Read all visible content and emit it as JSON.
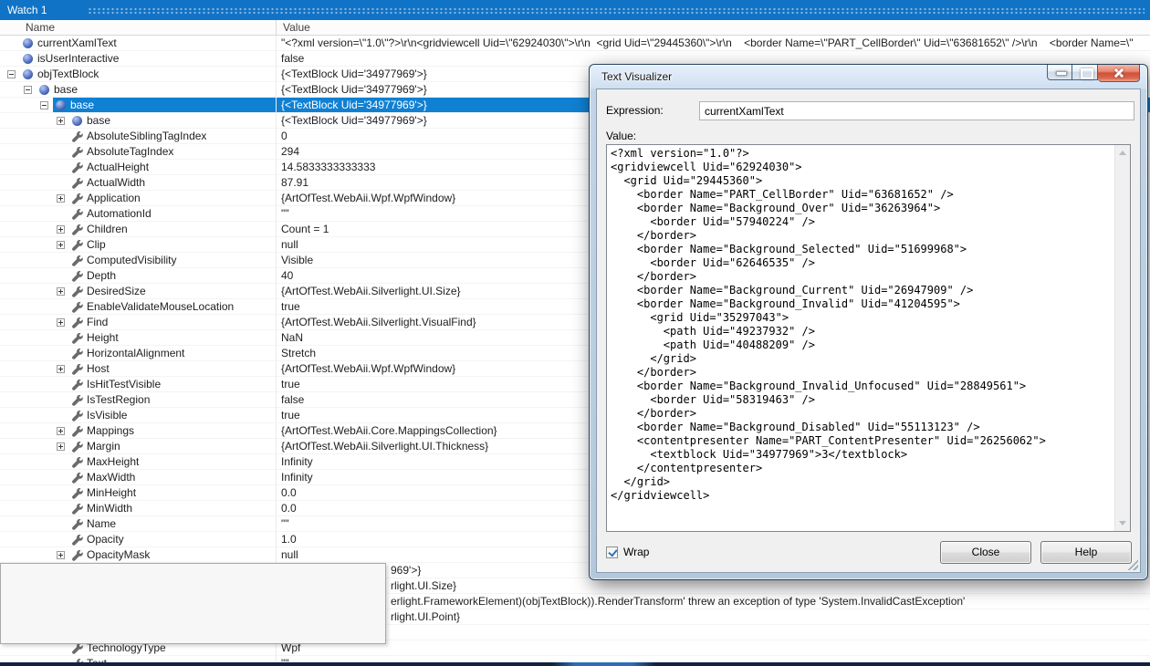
{
  "colors": {
    "titlebar_blue": "#1173c5",
    "selection_blue": "#1080d2",
    "close_red": "#cf523a"
  },
  "watch": {
    "title": "Watch 1",
    "columns": {
      "name": "Name",
      "value": "Value"
    },
    "rows": [
      {
        "name": "currentXamlText",
        "value": "\"<?xml version=\\\"1.0\\\"?>\\r\\n<gridviewcell Uid=\\\"62924030\\\">\\r\\n  <grid Uid=\\\"29445360\\\">\\r\\n    <border Name=\\\"PART_CellBorder\\\" Uid=\\\"63681652\\\" />\\r\\n    <border Name=\\\"",
        "level": 0,
        "icon": "sphere",
        "exp": "none"
      },
      {
        "name": "isUserInteractive",
        "value": "false",
        "level": 0,
        "icon": "sphere",
        "exp": "none"
      },
      {
        "name": "objTextBlock",
        "value": "{<TextBlock Uid='34977969'>}",
        "level": 0,
        "icon": "sphere",
        "exp": "minus"
      },
      {
        "name": "base",
        "value": "{<TextBlock Uid='34977969'>}",
        "level": 1,
        "icon": "sphere",
        "exp": "minus"
      },
      {
        "name": "base",
        "value": "{<TextBlock Uid='34977969'>}",
        "level": 2,
        "icon": "sphere",
        "exp": "minus",
        "selected": true
      },
      {
        "name": "base",
        "value": "{<TextBlock Uid='34977969'>}",
        "level": 3,
        "icon": "sphere",
        "exp": "plus"
      },
      {
        "name": "AbsoluteSiblingTagIndex",
        "value": "0",
        "level": 3,
        "icon": "wrench",
        "exp": "none"
      },
      {
        "name": "AbsoluteTagIndex",
        "value": "294",
        "level": 3,
        "icon": "wrench",
        "exp": "none"
      },
      {
        "name": "ActualHeight",
        "value": "14.5833333333333",
        "level": 3,
        "icon": "wrench",
        "exp": "none"
      },
      {
        "name": "ActualWidth",
        "value": "87.91",
        "level": 3,
        "icon": "wrench",
        "exp": "none"
      },
      {
        "name": "Application",
        "value": "{ArtOfTest.WebAii.Wpf.WpfWindow}",
        "level": 3,
        "icon": "wrench",
        "exp": "plus"
      },
      {
        "name": "AutomationId",
        "value": "\"\"",
        "level": 3,
        "icon": "wrench",
        "exp": "none"
      },
      {
        "name": "Children",
        "value": "Count = 1",
        "level": 3,
        "icon": "wrench",
        "exp": "plus"
      },
      {
        "name": "Clip",
        "value": "null",
        "level": 3,
        "icon": "wrench",
        "exp": "plus"
      },
      {
        "name": "ComputedVisibility",
        "value": "Visible",
        "level": 3,
        "icon": "wrench",
        "exp": "none"
      },
      {
        "name": "Depth",
        "value": "40",
        "level": 3,
        "icon": "wrench",
        "exp": "none"
      },
      {
        "name": "DesiredSize",
        "value": "{ArtOfTest.WebAii.Silverlight.UI.Size}",
        "level": 3,
        "icon": "wrench",
        "exp": "plus"
      },
      {
        "name": "EnableValidateMouseLocation",
        "value": "true",
        "level": 3,
        "icon": "wrench",
        "exp": "none"
      },
      {
        "name": "Find",
        "value": "{ArtOfTest.WebAii.Silverlight.VisualFind}",
        "level": 3,
        "icon": "wrench",
        "exp": "plus"
      },
      {
        "name": "Height",
        "value": "NaN",
        "level": 3,
        "icon": "wrench",
        "exp": "none"
      },
      {
        "name": "HorizontalAlignment",
        "value": "Stretch",
        "level": 3,
        "icon": "wrench",
        "exp": "none"
      },
      {
        "name": "Host",
        "value": "{ArtOfTest.WebAii.Wpf.WpfWindow}",
        "level": 3,
        "icon": "wrench",
        "exp": "plus"
      },
      {
        "name": "IsHitTestVisible",
        "value": "true",
        "level": 3,
        "icon": "wrench",
        "exp": "none"
      },
      {
        "name": "IsTestRegion",
        "value": "false",
        "level": 3,
        "icon": "wrench",
        "exp": "none"
      },
      {
        "name": "IsVisible",
        "value": "true",
        "level": 3,
        "icon": "wrench",
        "exp": "none"
      },
      {
        "name": "Mappings",
        "value": "{ArtOfTest.WebAii.Core.MappingsCollection}",
        "level": 3,
        "icon": "wrench",
        "exp": "plus"
      },
      {
        "name": "Margin",
        "value": "{ArtOfTest.WebAii.Silverlight.UI.Thickness}",
        "level": 3,
        "icon": "wrench",
        "exp": "plus"
      },
      {
        "name": "MaxHeight",
        "value": "Infinity",
        "level": 3,
        "icon": "wrench",
        "exp": "none"
      },
      {
        "name": "MaxWidth",
        "value": "Infinity",
        "level": 3,
        "icon": "wrench",
        "exp": "none"
      },
      {
        "name": "MinHeight",
        "value": "0.0",
        "level": 3,
        "icon": "wrench",
        "exp": "none"
      },
      {
        "name": "MinWidth",
        "value": "0.0",
        "level": 3,
        "icon": "wrench",
        "exp": "none"
      },
      {
        "name": "Name",
        "value": "\"\"",
        "level": 3,
        "icon": "wrench",
        "exp": "none"
      },
      {
        "name": "Opacity",
        "value": "1.0",
        "level": 3,
        "icon": "wrench",
        "exp": "none"
      },
      {
        "name": "OpacityMask",
        "value": "null",
        "level": 3,
        "icon": "wrench",
        "exp": "plus"
      },
      {
        "name": "",
        "value": "969'>}",
        "level": 3,
        "icon": "none",
        "exp": "none",
        "vx": 428
      },
      {
        "name": "",
        "value": "rlight.UI.Size}",
        "level": 3,
        "icon": "none",
        "exp": "none",
        "vx": 428
      },
      {
        "name": "",
        "value": "erlight.FrameworkElement)(objTextBlock)).RenderTransform' threw an exception of type 'System.InvalidCastException'",
        "level": 3,
        "icon": "none",
        "exp": "none",
        "vx": 428
      },
      {
        "name": "",
        "value": "rlight.UI.Point}",
        "level": 3,
        "icon": "none",
        "exp": "none",
        "vx": 428
      },
      {
        "name": "",
        "value": "",
        "level": 3,
        "icon": "none",
        "exp": "none"
      },
      {
        "name": "TechnologyType",
        "value": "Wpf",
        "level": 3,
        "icon": "wrench",
        "exp": "none"
      },
      {
        "name": "Text",
        "value": "\"\"",
        "level": 3,
        "icon": "wrench",
        "exp": "none"
      }
    ]
  },
  "visualizer": {
    "title": "Text Visualizer",
    "expression_label": "Expression:",
    "expression_value": "currentXamlText",
    "value_label": "Value:",
    "value_text": "<?xml version=\"1.0\"?>\n<gridviewcell Uid=\"62924030\">\n  <grid Uid=\"29445360\">\n    <border Name=\"PART_CellBorder\" Uid=\"63681652\" />\n    <border Name=\"Background_Over\" Uid=\"36263964\">\n      <border Uid=\"57940224\" />\n    </border>\n    <border Name=\"Background_Selected\" Uid=\"51699968\">\n      <border Uid=\"62646535\" />\n    </border>\n    <border Name=\"Background_Current\" Uid=\"26947909\" />\n    <border Name=\"Background_Invalid\" Uid=\"41204595\">\n      <grid Uid=\"35297043\">\n        <path Uid=\"49237932\" />\n        <path Uid=\"40488209\" />\n      </grid>\n    </border>\n    <border Name=\"Background_Invalid_Unfocused\" Uid=\"28849561\">\n      <border Uid=\"58319463\" />\n    </border>\n    <border Name=\"Background_Disabled\" Uid=\"55113123\" />\n    <contentpresenter Name=\"PART_ContentPresenter\" Uid=\"26256062\">\n      <textblock Uid=\"34977969\">3</textblock>\n    </contentpresenter>\n  </grid>\n</gridviewcell>",
    "wrap_label": "Wrap",
    "wrap_checked": true,
    "close_label": "Close",
    "help_label": "Help"
  }
}
